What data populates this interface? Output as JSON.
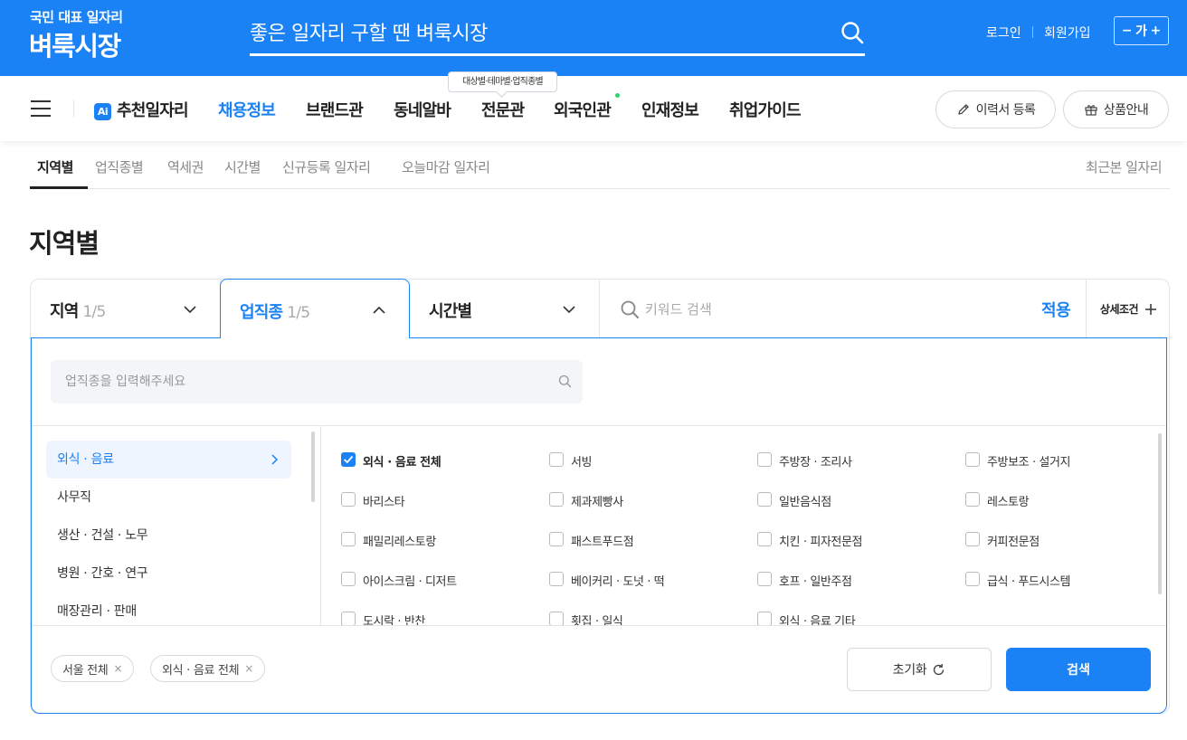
{
  "header": {
    "logo_sub": "국민 대표 일자리",
    "logo_main": "벼룩시장",
    "search_placeholder": "좋은 일자리 구할 땐 벼룩시장",
    "login": "로그인",
    "signup": "회원가입",
    "font_size": {
      "minus": "−",
      "label": "가",
      "plus": "+"
    }
  },
  "nav": {
    "ai_badge": "Ai",
    "items": [
      "추천일자리",
      "채용정보",
      "브랜드관",
      "동네알바",
      "전문관",
      "외국인관",
      "인재정보",
      "취업가이드"
    ],
    "active_index": 1,
    "tooltip": "대상별·테마별·업직종별",
    "resume_button": "이력서 등록",
    "product_button": "상품안내"
  },
  "subtabs": {
    "items": [
      "지역별",
      "업직종별",
      "역세권",
      "시간별",
      "신규등록 일자리",
      "오늘마감 일자리"
    ],
    "active_index": 0,
    "recent": "최근본 일자리"
  },
  "page_title": "지역별",
  "filter": {
    "region": {
      "label": "지역",
      "count": "1/5"
    },
    "job": {
      "label": "업직종",
      "count": "1/5"
    },
    "time": {
      "label": "시간별"
    },
    "keyword_placeholder": "키워드 검색",
    "apply": "적용",
    "detail": "상세조건",
    "job_search_placeholder": "업직종을 입력해주세요",
    "categories": [
      "외식 · 음료",
      "사무직",
      "생산 · 건설 · 노무",
      "병원 · 간호 · 연구",
      "매장관리 · 판매"
    ],
    "active_category": 0,
    "options": [
      "외식 · 음료 전체",
      "서빙",
      "주방장 · 조리사",
      "주방보조 · 설거지",
      "바리스타",
      "제과제빵사",
      "일반음식점",
      "레스토랑",
      "패밀리레스토랑",
      "패스트푸드점",
      "치킨 · 피자전문점",
      "커피전문점",
      "아이스크림 · 디저트",
      "베이커리 · 도넛 · 떡",
      "호프 · 일반주점",
      "급식 · 푸드시스템",
      "도시락 · 반찬",
      "횟집 · 일식",
      "외식 · 음료 기타"
    ],
    "checked_index": 0,
    "chips": [
      "서울 전체",
      "외식 · 음료 전체"
    ],
    "chip_remove": "×",
    "reset": "초기화",
    "search": "검색"
  },
  "colors": {
    "brand": "#1b82f5",
    "new_dot": "#2fd26d"
  }
}
